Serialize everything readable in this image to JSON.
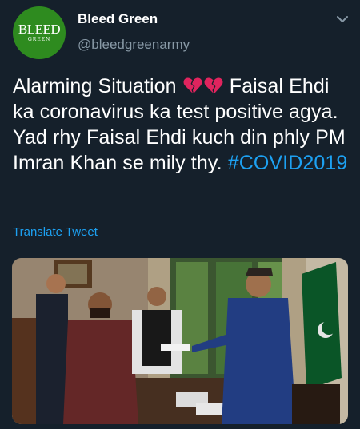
{
  "header": {
    "avatar_main": "BLEED",
    "avatar_sub": "GREEN",
    "display_name": "Bleed Green",
    "handle": "@bleedgreenarmy"
  },
  "tweet": {
    "text_part1": "Alarming Situation ",
    "text_part2": " Faisal Ehdi ka coronavirus ka test positive agya. Yad rhy Faisal Ehdi kuch din phly PM Imran Khan se mily thy. ",
    "hashtag": "#COVID2019",
    "emoji_icons": [
      "broken-heart-icon",
      "broken-heart-icon"
    ],
    "translate_label": "Translate Tweet"
  },
  "colors": {
    "background": "#15202b",
    "text": "#ffffff",
    "secondary": "#8899a6",
    "accent": "#1da1f2",
    "avatar_bg": "#2e8b1f",
    "broken_heart": "#e0245e"
  }
}
